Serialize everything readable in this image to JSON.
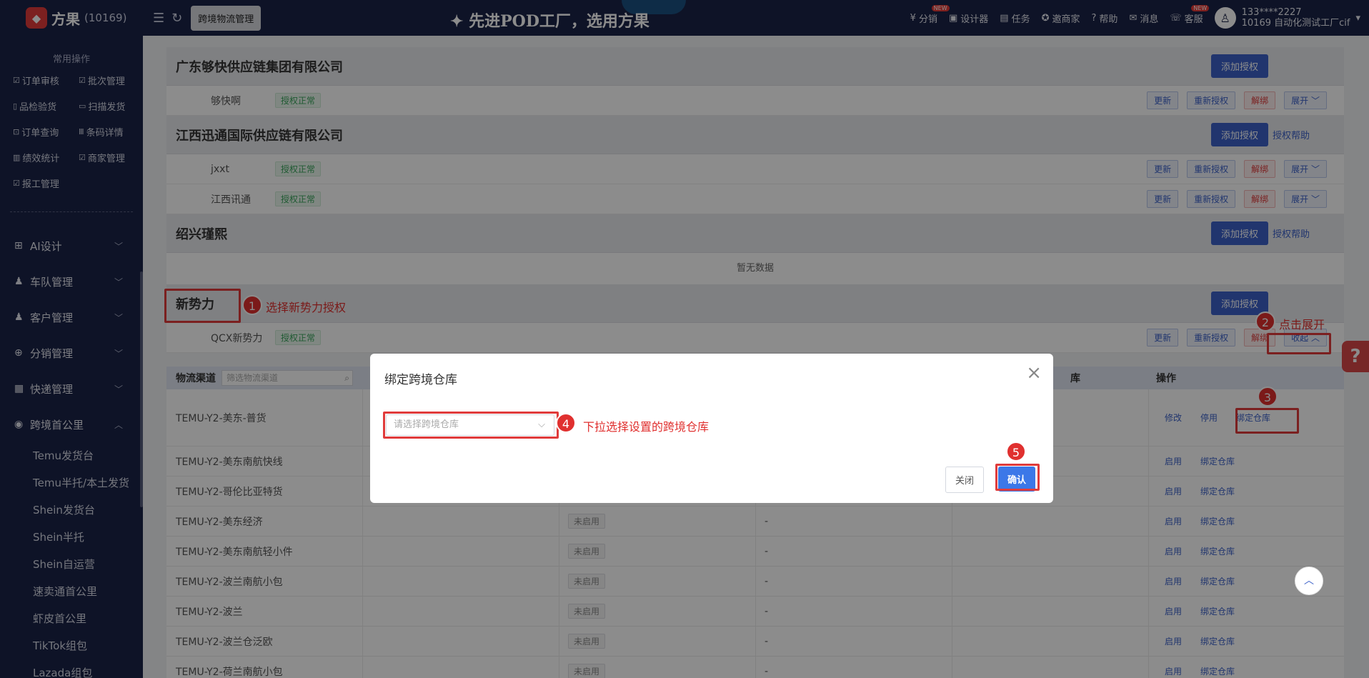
{
  "topbar": {
    "brand": "方果",
    "brand_count": "(10169)",
    "logistics_tag": "跨境物流管理",
    "slogan": "先进POD工厂，选用方果",
    "slogan_star": "✦",
    "items": [
      {
        "label": "分销",
        "icon": "coin-icon",
        "glyph": "¥",
        "new": "NEW"
      },
      {
        "label": "设计器",
        "icon": "image-icon",
        "glyph": "▣",
        "new": ""
      },
      {
        "label": "任务",
        "icon": "task-icon",
        "glyph": "▤",
        "new": ""
      },
      {
        "label": "邀商家",
        "icon": "invite-icon",
        "glyph": "✪",
        "new": ""
      },
      {
        "label": "帮助",
        "icon": "help-icon",
        "glyph": "?",
        "new": ""
      },
      {
        "label": "消息",
        "icon": "message-icon",
        "glyph": "✉",
        "new": ""
      },
      {
        "label": "客服",
        "icon": "service-icon",
        "glyph": "☏",
        "new": "NEW"
      }
    ],
    "user_phone": "133****2227",
    "user_factory": "10169 自动化测试工厂cif"
  },
  "sidebar": {
    "title": "常用操作",
    "quick": [
      {
        "label": "订单审核",
        "glyph": "☑"
      },
      {
        "label": "批次管理",
        "glyph": "☑"
      },
      {
        "label": "品检验货",
        "glyph": "▯"
      },
      {
        "label": "扫描发货",
        "glyph": "▭"
      },
      {
        "label": "订单查询",
        "glyph": "⊡"
      },
      {
        "label": "条码详情",
        "glyph": "Ⅲ"
      },
      {
        "label": "绩效统计",
        "glyph": "▥"
      },
      {
        "label": "商家管理",
        "glyph": "☑"
      },
      {
        "label": "报工管理",
        "glyph": "☑"
      }
    ],
    "menu": [
      {
        "label": "AI设计",
        "glyph": "⊞",
        "arrow": "﹀"
      },
      {
        "label": "车队管理",
        "glyph": "♟",
        "arrow": "﹀"
      },
      {
        "label": "客户管理",
        "glyph": "♟",
        "arrow": "﹀"
      },
      {
        "label": "分销管理",
        "glyph": "⊕",
        "arrow": "﹀"
      },
      {
        "label": "快递管理",
        "glyph": "▦",
        "arrow": "﹀"
      },
      {
        "label": "跨境首公里",
        "glyph": "◉",
        "arrow": "︿"
      }
    ],
    "sub": [
      "Temu发货台",
      "Temu半托/本土发货",
      "Shein发货台",
      "Shein半托",
      "Shein自运营",
      "速卖通首公里",
      "虾皮首公里",
      "TikTok组包",
      "Lazada组包"
    ]
  },
  "groups": [
    {
      "name": "广东够快供应链集团有限公司",
      "add": "添加授权",
      "help": "",
      "rows": [
        {
          "name": "够快啊",
          "status": "授权正常"
        }
      ]
    },
    {
      "name": "江西迅通国际供应链有限公司",
      "add": "添加授权",
      "help": "授权帮助",
      "rows": [
        {
          "name": "jxxt",
          "status": "授权正常"
        },
        {
          "name": "江西讯通",
          "status": "授权正常"
        }
      ]
    },
    {
      "name": "绍兴瑾熙",
      "add": "添加授权",
      "help": "授权帮助",
      "rows": []
    },
    {
      "name": "新势力",
      "add": "添加授权",
      "help": "",
      "rows": [
        {
          "name": "QCX新势力",
          "status": "授权正常"
        }
      ]
    }
  ],
  "row_actions": {
    "update": "更新",
    "reauth": "重新授权",
    "unbind": "解绑",
    "expand": "展开",
    "collapse": "收起"
  },
  "nodata": "暂无数据",
  "table": {
    "header_channel": "物流渠道",
    "search_placeholder": "筛选物流渠道",
    "header_warehouse_partial": "库",
    "header_ops": "操作",
    "rows": [
      {
        "channel": "TEMU-Y2-美东-普货",
        "status": "",
        "dash": "",
        "op1": "修改",
        "op2": "停用",
        "op3": "绑定仓库"
      },
      {
        "channel": "TEMU-Y2-美东南航快线",
        "status": "",
        "dash": "",
        "op1": "启用",
        "op2": "绑定仓库",
        "op3": ""
      },
      {
        "channel": "TEMU-Y2-哥伦比亚特货",
        "status": "",
        "dash": "",
        "op1": "启用",
        "op2": "绑定仓库",
        "op3": ""
      },
      {
        "channel": "TEMU-Y2-美东经济",
        "status": "未启用",
        "dash": "-",
        "op1": "启用",
        "op2": "绑定仓库",
        "op3": ""
      },
      {
        "channel": "TEMU-Y2-美东南航轻小件",
        "status": "未启用",
        "dash": "-",
        "op1": "启用",
        "op2": "绑定仓库",
        "op3": ""
      },
      {
        "channel": "TEMU-Y2-波兰南航小包",
        "status": "未启用",
        "dash": "-",
        "op1": "启用",
        "op2": "绑定仓库",
        "op3": ""
      },
      {
        "channel": "TEMU-Y2-波兰",
        "status": "未启用",
        "dash": "-",
        "op1": "启用",
        "op2": "绑定仓库",
        "op3": ""
      },
      {
        "channel": "TEMU-Y2-波兰仓泛欧",
        "status": "未启用",
        "dash": "-",
        "op1": "启用",
        "op2": "绑定仓库",
        "op3": ""
      },
      {
        "channel": "TEMU-Y2-荷兰南航小包",
        "status": "未启用",
        "dash": "-",
        "op1": "启用",
        "op2": "绑定仓库",
        "op3": ""
      }
    ]
  },
  "annotations": {
    "n1": "1",
    "t1": "选择新势力授权",
    "n2": "2",
    "t2": "点击展开",
    "n3": "3",
    "n4": "4",
    "t4": "下拉选择设置的跨境仓库",
    "n5": "5"
  },
  "modal": {
    "title": "绑定跨境仓库",
    "select_placeholder": "请选择跨境仓库",
    "close_label": "关闭",
    "confirm_label": "确认"
  },
  "float_help": "?",
  "colors": {
    "primary": "#3c62c9",
    "danger": "#e03b3b",
    "success": "#3aa55c",
    "sidebar": "#1b2347"
  }
}
